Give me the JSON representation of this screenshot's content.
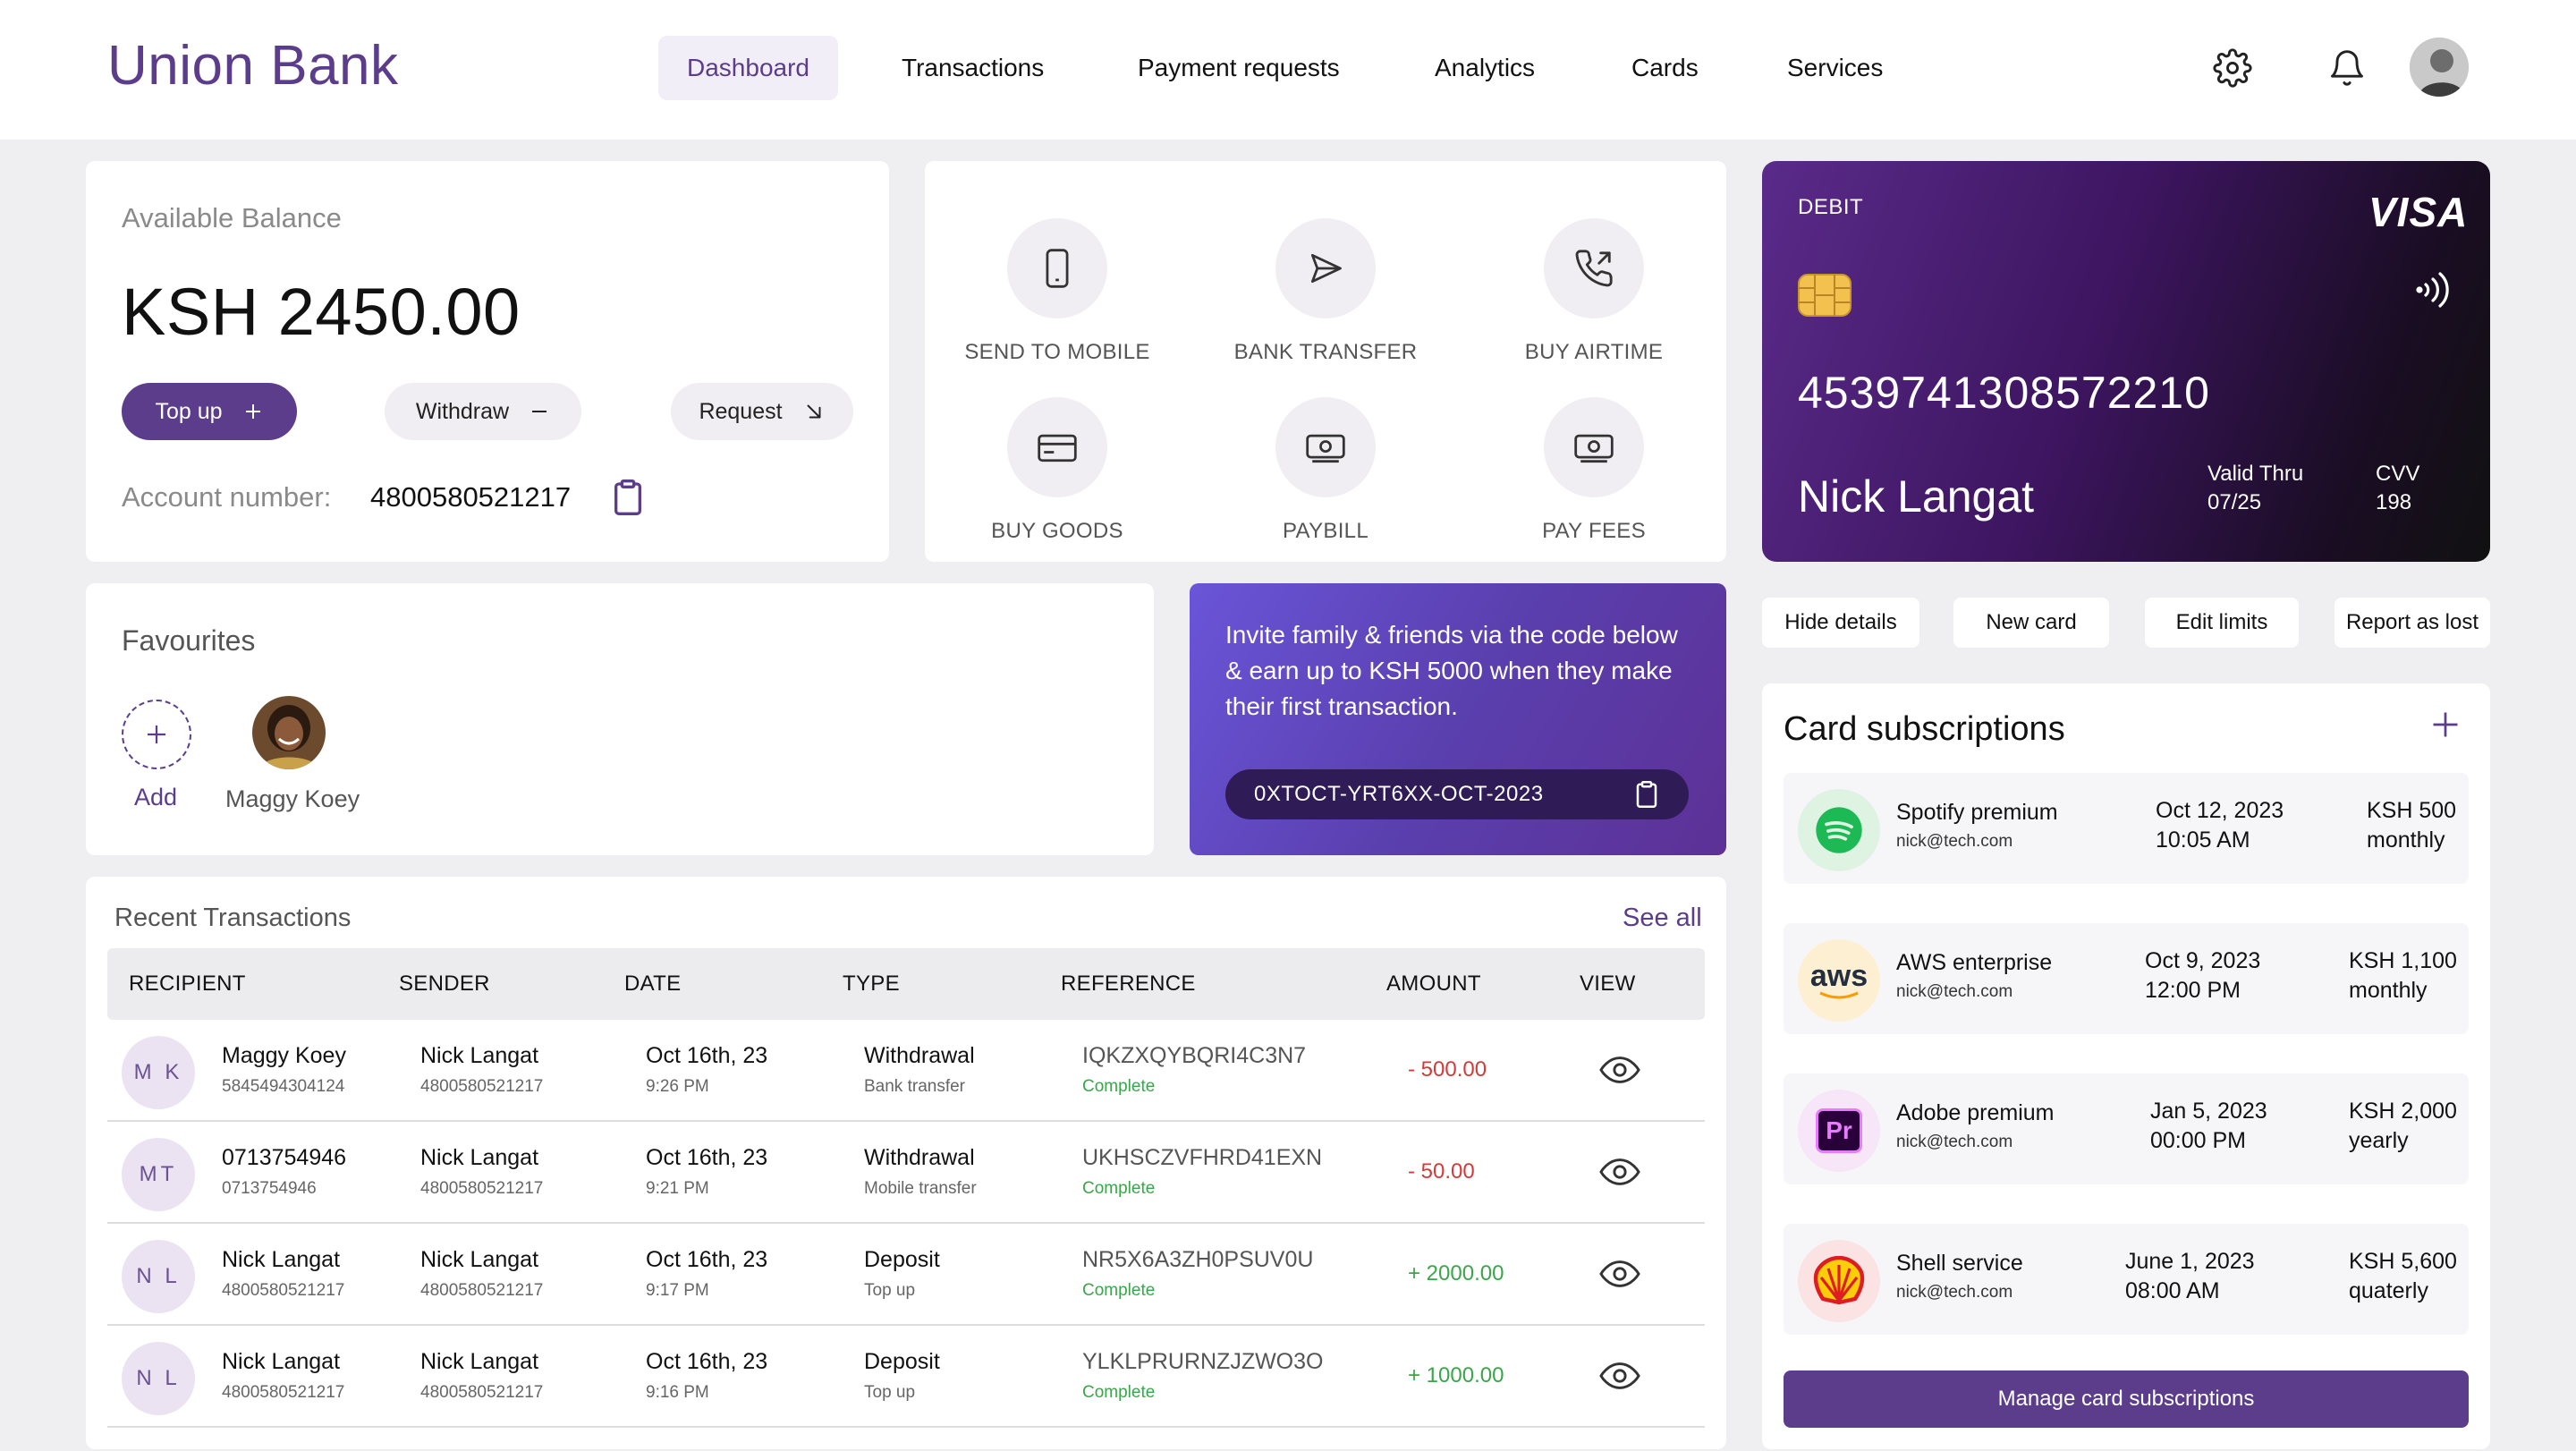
{
  "brand": "Union Bank",
  "nav": [
    "Dashboard",
    "Transactions",
    "Payment requests",
    "Analytics",
    "Cards",
    "Services"
  ],
  "active_nav": "Dashboard",
  "icons": {
    "settings": "gear-icon",
    "notifications": "bell-icon"
  },
  "colors": {
    "accent": "#5b3d8c",
    "negative": "#d43a3a",
    "positive": "#3aa64a"
  },
  "balance": {
    "label": "Available Balance",
    "amount": "KSH 2450.00",
    "topup_label": "Top up",
    "withdraw_label": "Withdraw",
    "request_label": "Request",
    "account_label": "Account number:",
    "account_number": "4800580521217"
  },
  "actions": [
    {
      "label": "SEND TO MOBILE",
      "icon": "phone-icon"
    },
    {
      "label": "BANK TRANSFER",
      "icon": "send-icon"
    },
    {
      "label": "BUY AIRTIME",
      "icon": "phone-call-icon"
    },
    {
      "label": "BUY GOODS",
      "icon": "credit-card-icon"
    },
    {
      "label": "PAYBILL",
      "icon": "banknote-icon"
    },
    {
      "label": "PAY FEES",
      "icon": "banknote-icon"
    }
  ],
  "debit_card": {
    "type": "DEBIT",
    "brand": "VISA",
    "number": "4539741308572210",
    "holder": "Nick Langat",
    "valid_label": "Valid Thru",
    "valid_value": "07/25",
    "cvv_label": "CVV",
    "cvv_value": "198"
  },
  "card_options": [
    "Hide details",
    "New card",
    "Edit limits",
    "Report as lost"
  ],
  "favourites": {
    "title": "Favourites",
    "add_label": "Add",
    "contacts": [
      "Maggy Koey"
    ]
  },
  "invite": {
    "text": "Invite family & friends via the code below & earn up to KSH 5000 when they make their first transaction.",
    "code": "0XTOCT-YRT6XX-OCT-2023"
  },
  "transactions": {
    "title": "Recent Transactions",
    "see_all": "See all",
    "columns": [
      "RECIPIENT",
      "SENDER",
      "DATE",
      "TYPE",
      "REFERENCE",
      "AMOUNT",
      "VIEW"
    ],
    "rows": [
      {
        "initials": "M K",
        "recipient": "Maggy Koey",
        "recipient_acct": "5845494304124",
        "sender": "Nick Langat",
        "sender_acct": "4800580521217",
        "date": "Oct 16th, 23",
        "time": "9:26 PM",
        "type": "Withdrawal",
        "subtype": "Bank transfer",
        "reference": "IQKZXQYBQRI4C3N7",
        "status": "Complete",
        "amount": "- 500.00",
        "direction": "out"
      },
      {
        "initials": "MT",
        "recipient": "0713754946",
        "recipient_acct": "0713754946",
        "sender": "Nick Langat",
        "sender_acct": "4800580521217",
        "date": "Oct 16th, 23",
        "time": "9:21 PM",
        "type": "Withdrawal",
        "subtype": "Mobile transfer",
        "reference": "UKHSCZVFHRD41EXN",
        "status": "Complete",
        "amount": "- 50.00",
        "direction": "out"
      },
      {
        "initials": "N L",
        "recipient": "Nick Langat",
        "recipient_acct": "4800580521217",
        "sender": "Nick Langat",
        "sender_acct": "4800580521217",
        "date": "Oct 16th, 23",
        "time": "9:17 PM",
        "type": "Deposit",
        "subtype": "Top up",
        "reference": "NR5X6A3ZH0PSUV0U",
        "status": "Complete",
        "amount": "+ 2000.00",
        "direction": "in"
      },
      {
        "initials": "N L",
        "recipient": "Nick Langat",
        "recipient_acct": "4800580521217",
        "sender": "Nick Langat",
        "sender_acct": "4800580521217",
        "date": "Oct 16th, 23",
        "time": "9:16 PM",
        "type": "Deposit",
        "subtype": "Top up",
        "reference": "YLKLPRURNZJZWO3O",
        "status": "Complete",
        "amount": "+ 1000.00",
        "direction": "in"
      }
    ]
  },
  "subscriptions": {
    "title": "Card subscriptions",
    "manage_label": "Manage card subscriptions",
    "items": [
      {
        "name": "Spotify premium",
        "email": "nick@tech.com",
        "date": "Oct 12, 2023",
        "time": "10:05 AM",
        "price": "KSH 500",
        "period": "monthly",
        "logo": "spotify-logo"
      },
      {
        "name": "AWS enterprise",
        "email": "nick@tech.com",
        "date": "Oct 9, 2023",
        "time": "12:00 PM",
        "price": "KSH 1,100",
        "period": "monthly",
        "logo": "aws-logo",
        "logo_text": "aws"
      },
      {
        "name": "Adobe premium",
        "email": "nick@tech.com",
        "date": "Jan 5, 2023",
        "time": "00:00 PM",
        "price": "KSH 2,000",
        "period": "yearly",
        "logo": "adobe-premiere-logo",
        "logo_text": "Pr"
      },
      {
        "name": "Shell service",
        "email": "nick@tech.com",
        "date": "June 1, 2023",
        "time": "08:00 AM",
        "price": "KSH 5,600",
        "period": "quaterly",
        "logo": "shell-logo"
      }
    ]
  }
}
